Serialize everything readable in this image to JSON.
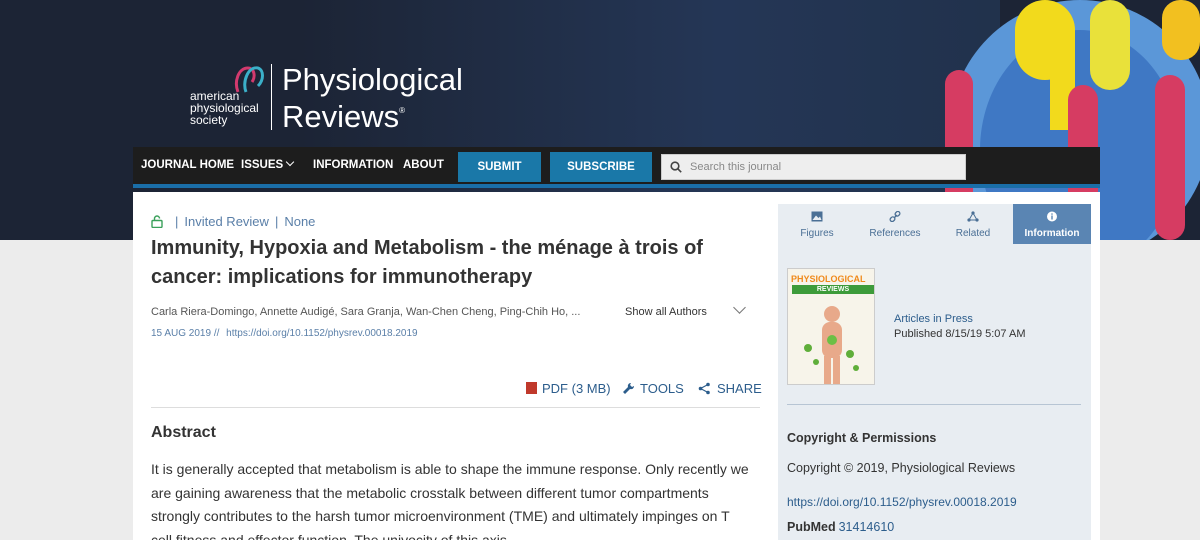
{
  "header": {
    "publisher_lines": [
      "american",
      "physiological",
      "society"
    ],
    "journal_title_line1": "Physiological",
    "journal_title_line2": "Reviews",
    "registered_mark": "®"
  },
  "nav": {
    "items": [
      {
        "label": "JOURNAL HOME"
      },
      {
        "label": "ISSUES"
      },
      {
        "label": "INFORMATION"
      },
      {
        "label": "ABOUT"
      }
    ],
    "submit_label": "SUBMIT",
    "subscribe_label": "SUBSCRIBE",
    "search_placeholder": "Search this journal",
    "accent_color": "#1a78a8"
  },
  "article": {
    "access": "Invited Review",
    "section": "None",
    "title": "Immunity, Hypoxia and Metabolism - the ménage à trois of cancer: implications for immunotherapy",
    "authors": "Carla Riera-Domingo, Annette Audigé, Sara Granja, Wan-Chen Cheng, Ping-Chih Ho, ...",
    "show_all": "Show all Authors",
    "date": "15 AUG 2019",
    "date_sep": "//",
    "doi": "https://doi.org/10.1152/physrev.00018.2019",
    "tools": {
      "pdf": "PDF (3 MB)",
      "tools": "TOOLS",
      "share": "SHARE"
    },
    "abstract_heading": "Abstract",
    "abstract_text": "It is generally accepted that metabolism is able to shape the immune response. Only recently we are gaining awareness that the metabolic crosstalk between different tumor compartments strongly contributes to the harsh tumor microenvironment (TME) and ultimately impinges on T cell fitness and effector function. The univocity of this axis"
  },
  "sidebar": {
    "tabs": [
      {
        "label": "Figures",
        "icon": "image-icon"
      },
      {
        "label": "References",
        "icon": "link-icon"
      },
      {
        "label": "Related",
        "icon": "network-icon"
      },
      {
        "label": "Information",
        "icon": "info-icon"
      }
    ],
    "active_tab": "Information",
    "cover_title_line1": "PHYSIOLOGICAL",
    "cover_title_line2": "REVIEWS",
    "pub_status": "Articles in Press",
    "published": "Published 8/15/19 5:07 AM",
    "copyright_heading": "Copyright & Permissions",
    "copyright_text": "Copyright © 2019, Physiological Reviews",
    "doi": "https://doi.org/10.1152/physrev.00018.2019",
    "pubmed_label": "PubMed",
    "pubmed_id": "31414610"
  }
}
